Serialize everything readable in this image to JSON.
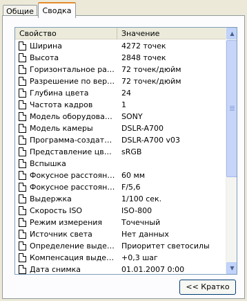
{
  "tabs": [
    {
      "label": "Общие"
    },
    {
      "label": "Сводка"
    }
  ],
  "columns": {
    "property": "Свойство",
    "value": "Значение"
  },
  "rows": [
    {
      "property": "Ширина",
      "value": "4272 точек"
    },
    {
      "property": "Высота",
      "value": "2848 точек"
    },
    {
      "property": "Горизонтальное разр...",
      "value": "72 точек/дюйм"
    },
    {
      "property": "Разрешение по верти...",
      "value": "72 точек/дюйм"
    },
    {
      "property": "Глубина цвета",
      "value": "24"
    },
    {
      "property": "Частота кадров",
      "value": "1"
    },
    {
      "property": "Модель оборудования",
      "value": "SONY"
    },
    {
      "property": "Модель камеры",
      "value": "DSLR-A700"
    },
    {
      "property": "Программа-создатель",
      "value": "DSLR-A700 v03"
    },
    {
      "property": "Представление цвета",
      "value": "sRGB"
    },
    {
      "property": "Вспышка",
      "value": ""
    },
    {
      "property": "Фокусное расстояние",
      "value": "60 мм"
    },
    {
      "property": "Фокусное расстояние",
      "value": "F/5,6"
    },
    {
      "property": "Выдержка",
      "value": "1/100 сек."
    },
    {
      "property": "Скорость ISO",
      "value": "ISO-800"
    },
    {
      "property": "Режим измерения",
      "value": "Точечный"
    },
    {
      "property": "Источник света",
      "value": "Нет данных"
    },
    {
      "property": "Определение выдержки",
      "value": "Приоритет светосилы"
    },
    {
      "property": "Компенсация выдержки",
      "value": "+0,3 шаг"
    },
    {
      "property": "Дата снимка",
      "value": "01.01.2007 0:00"
    }
  ],
  "brief_button": {
    "label": "<< Кратко"
  },
  "colors": {
    "active_tab_accent": "#e68b2c",
    "panel_bg": "#fcfcfe",
    "window_bg": "#ece9d8"
  }
}
